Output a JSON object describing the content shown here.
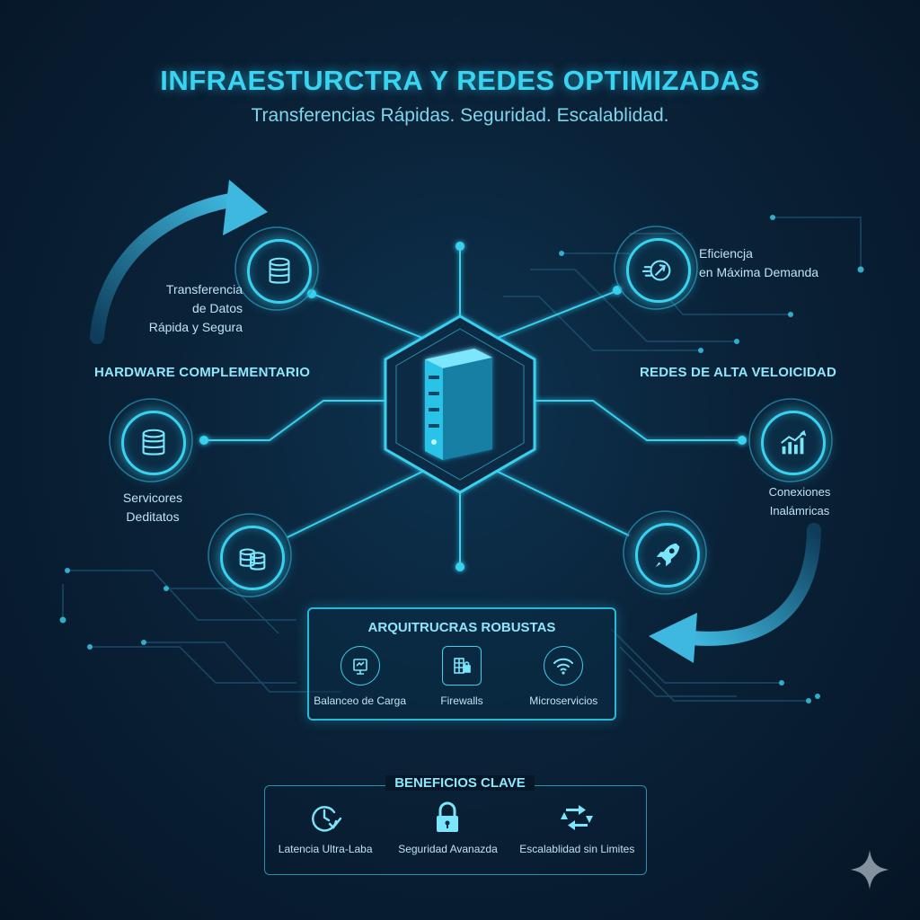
{
  "header": {
    "title": "INFRAESTURCTRA Y REDES OPTIMIZADAS",
    "subtitle": "Transferencias Rápidas. Seguridad. Escalablidad."
  },
  "nodes": {
    "transfer": {
      "label_line1": "Transferencia",
      "label_line2": "de Datos",
      "label_line3": "Rápida y Segura",
      "icon": "database-icon"
    },
    "servers": {
      "label_line1": "Servicores",
      "label_line2": "Deditatos",
      "icon": "server-stack-icon"
    },
    "storage": {
      "icon": "storage-icon"
    },
    "efficiency": {
      "label_line1": "Eficiencja",
      "label_line2": "en Máxima Demanda",
      "icon": "speed-icon"
    },
    "wireless": {
      "label_line1": "Conexiones",
      "label_line2": "Inalámricas",
      "icon": "chart-up-icon"
    },
    "rocket": {
      "icon": "rocket-icon"
    }
  },
  "sections": {
    "left": "HARDWARE COMPLEMENTARIO",
    "right": "REDES DE ALTA VELOICIDAD"
  },
  "architecture": {
    "title": "ARQUITRUCRAS ROBUSTAS",
    "items": [
      {
        "label": "Balanceo de Carga",
        "icon": "balance-icon"
      },
      {
        "label": "Firewalls",
        "icon": "firewall-icon"
      },
      {
        "label": "Microservicios",
        "icon": "wifi-icon"
      }
    ]
  },
  "benefits": {
    "title": "BENEFICIOS CLAVE",
    "items": [
      {
        "label": "Latencia Ultra-Laba",
        "icon": "clock-check-icon"
      },
      {
        "label": "Seguridad Avanazda",
        "icon": "lock-icon"
      },
      {
        "label": "Escalablidad sin Limites",
        "icon": "scale-arrows-icon"
      }
    ]
  },
  "colors": {
    "accent": "#38d1f0",
    "background": "#0a2238",
    "text": "#bfe3f2"
  }
}
